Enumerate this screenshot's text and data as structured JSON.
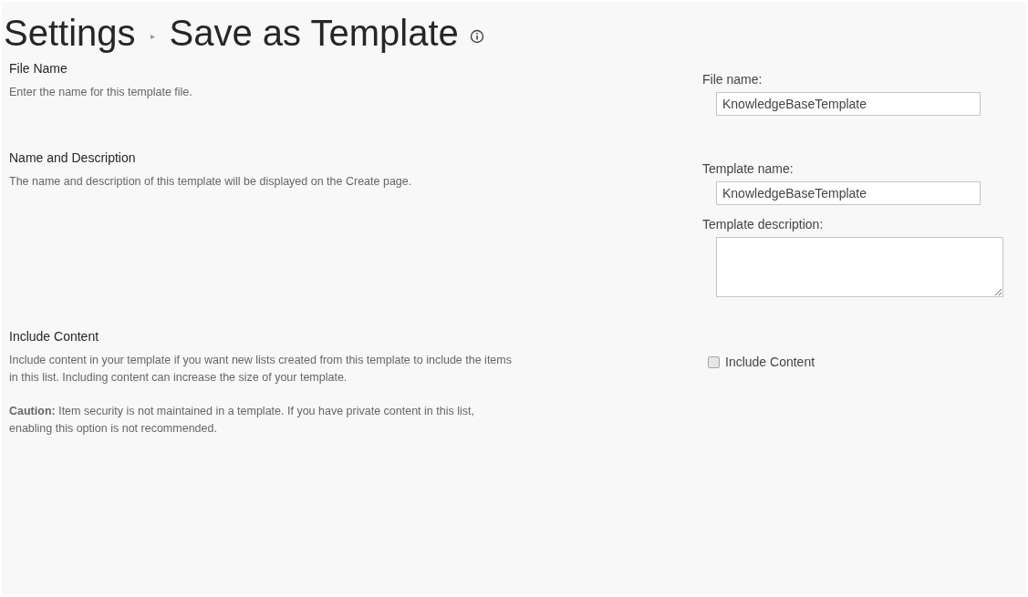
{
  "breadcrumb": {
    "parent": "Settings",
    "separator": "▸",
    "current": "Save as Template"
  },
  "sections": [
    {
      "heading": "File Name",
      "paragraphs": [
        "Enter the name for this template file."
      ],
      "fields": [
        {
          "kind": "text",
          "label": "File name:",
          "value": "KnowledgeBaseTemplate"
        }
      ]
    },
    {
      "heading": "Name and Description",
      "paragraphs": [
        "The name and description of this template will be displayed on the Create page."
      ],
      "fields": [
        {
          "kind": "text",
          "label": "Template name:",
          "value": "KnowledgeBaseTemplate"
        },
        {
          "kind": "textarea",
          "label": "Template description:"
        }
      ]
    },
    {
      "heading": "Include Content",
      "paragraphs": [
        "Include content in your template if you want new lists created from this template to include the items in this list. Including content can increase the size of your template.",
        "**Caution:** Item security is not maintained in a template. If you have private content in this list, enabling this option is not recommended."
      ],
      "fields": [
        {
          "kind": "checkbox",
          "label": "Include Content",
          "checked": false
        }
      ]
    }
  ]
}
